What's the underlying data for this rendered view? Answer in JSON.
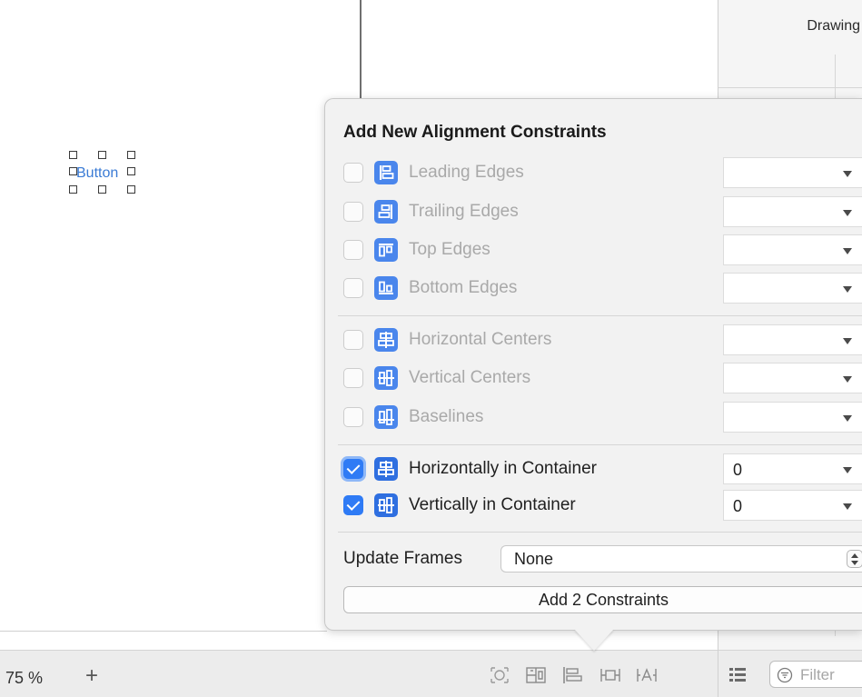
{
  "canvas": {
    "button_label": "Button",
    "zoom": "75 %",
    "zoom_in": "+"
  },
  "inspector": {
    "title": "Drawing",
    "filter_placeholder": "Filter"
  },
  "popover": {
    "title": "Add New Alignment Constraints",
    "rows": [
      {
        "label": "Leading Edges",
        "checked": false,
        "value": "",
        "icon": "leading-edges-icon"
      },
      {
        "label": "Trailing Edges",
        "checked": false,
        "value": "",
        "icon": "trailing-edges-icon"
      },
      {
        "label": "Top Edges",
        "checked": false,
        "value": "",
        "icon": "top-edges-icon"
      },
      {
        "label": "Bottom Edges",
        "checked": false,
        "value": "",
        "icon": "bottom-edges-icon"
      },
      {
        "label": "Horizontal Centers",
        "checked": false,
        "value": "",
        "icon": "horizontal-centers-icon"
      },
      {
        "label": "Vertical Centers",
        "checked": false,
        "value": "",
        "icon": "vertical-centers-icon"
      },
      {
        "label": "Baselines",
        "checked": false,
        "value": "",
        "icon": "baselines-icon"
      },
      {
        "label": "Horizontally in Container",
        "checked": true,
        "value": "0",
        "icon": "horizontally-in-container-icon"
      },
      {
        "label": "Vertically in Container",
        "checked": true,
        "value": "0",
        "icon": "vertically-in-container-icon"
      }
    ],
    "update_frames_label": "Update Frames",
    "update_frames_value": "None",
    "add_button_label": "Add 2 Constraints"
  },
  "toolbar_icons": [
    "update-frames-icon",
    "stack-icon",
    "align-icon",
    "pin-icon",
    "resolve-issues-icon"
  ],
  "colors": {
    "accent": "#2f7bf5",
    "icon_blue": "#2f6fe0",
    "dim_text": "#a9a9a9"
  }
}
